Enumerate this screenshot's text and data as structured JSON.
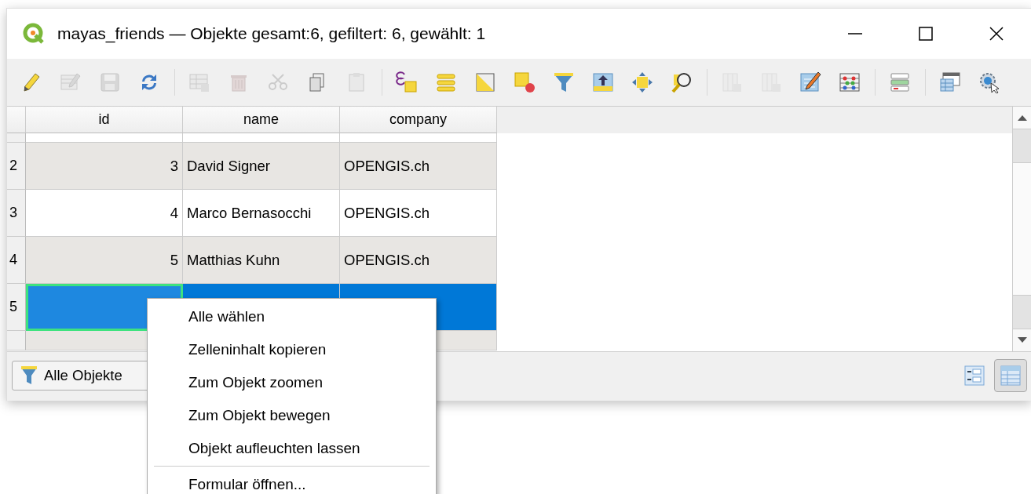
{
  "window": {
    "title": "mayas_friends — Objekte gesamt:6, gefiltert: 6, gewählt: 1"
  },
  "toolbar": [
    {
      "kind": "button",
      "disabled": false
    },
    {
      "kind": "button",
      "disabled": true
    },
    {
      "kind": "button",
      "disabled": true
    },
    {
      "kind": "button",
      "disabled": false
    },
    {
      "kind": "separator"
    },
    {
      "kind": "button",
      "disabled": true
    },
    {
      "kind": "button",
      "disabled": true
    },
    {
      "kind": "button",
      "disabled": true
    },
    {
      "kind": "button",
      "disabled": false
    },
    {
      "kind": "button",
      "disabled": true
    },
    {
      "kind": "separator"
    },
    {
      "kind": "button",
      "disabled": false
    },
    {
      "kind": "button",
      "disabled": false
    },
    {
      "kind": "button",
      "disabled": false
    },
    {
      "kind": "button",
      "disabled": false
    },
    {
      "kind": "button",
      "disabled": false
    },
    {
      "kind": "button",
      "disabled": false
    },
    {
      "kind": "button",
      "disabled": false
    },
    {
      "kind": "button",
      "disabled": false
    },
    {
      "kind": "separator"
    },
    {
      "kind": "button",
      "disabled": true
    },
    {
      "kind": "button",
      "disabled": true
    },
    {
      "kind": "button",
      "disabled": false
    },
    {
      "kind": "button",
      "disabled": false
    },
    {
      "kind": "separator"
    },
    {
      "kind": "button",
      "disabled": false
    },
    {
      "kind": "separator"
    },
    {
      "kind": "button",
      "disabled": false
    },
    {
      "kind": "button",
      "disabled": false
    }
  ],
  "table": {
    "columns": [
      {
        "label": "id",
        "kind": "number"
      },
      {
        "label": "name",
        "kind": "text"
      },
      {
        "label": "company",
        "kind": "text"
      }
    ],
    "rows": [
      {
        "header": "2",
        "selected": false,
        "cells": [
          {
            "text": "3",
            "current": false
          },
          {
            "text": "David Signer",
            "current": false
          },
          {
            "text": "OPENGIS.ch",
            "current": false
          }
        ]
      },
      {
        "header": "3",
        "selected": false,
        "cells": [
          {
            "text": "4",
            "current": false
          },
          {
            "text": "Marco Bernasocchi",
            "current": false
          },
          {
            "text": "OPENGIS.ch",
            "current": false
          }
        ]
      },
      {
        "header": "4",
        "selected": false,
        "cells": [
          {
            "text": "5",
            "current": false
          },
          {
            "text": "Matthias Kuhn",
            "current": false
          },
          {
            "text": "OPENGIS.ch",
            "current": false
          }
        ]
      },
      {
        "header": "5",
        "selected": true,
        "cells": [
          {
            "current": true
          },
          {
            "current": false
          },
          {
            "current": false
          }
        ]
      }
    ]
  },
  "bottom_bar": {
    "filter_button": {
      "label": "Alle Objekte"
    },
    "view_buttons": [
      {
        "selected": false
      },
      {
        "selected": true
      }
    ]
  },
  "context_menu": [
    {
      "kind": "item",
      "label": "Alle wählen"
    },
    {
      "kind": "item",
      "label": "Zelleninhalt kopieren"
    },
    {
      "kind": "item",
      "label": "Zum Objekt zoomen"
    },
    {
      "kind": "item",
      "label": "Zum Objekt bewegen"
    },
    {
      "kind": "item",
      "label": "Objekt aufleuchten lassen"
    },
    {
      "kind": "separator"
    },
    {
      "kind": "item",
      "label": "Formular öffnen..."
    }
  ]
}
